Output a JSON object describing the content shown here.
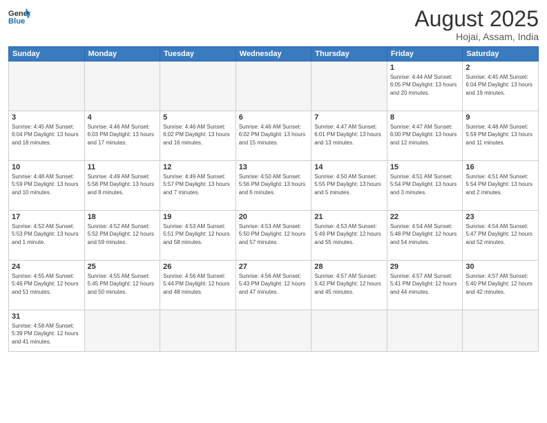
{
  "header": {
    "logo_general": "General",
    "logo_blue": "Blue",
    "month_title": "August 2025",
    "location": "Hojai, Assam, India"
  },
  "days_of_week": [
    "Sunday",
    "Monday",
    "Tuesday",
    "Wednesday",
    "Thursday",
    "Friday",
    "Saturday"
  ],
  "weeks": [
    [
      {
        "day": "",
        "info": "",
        "empty": true
      },
      {
        "day": "",
        "info": "",
        "empty": true
      },
      {
        "day": "",
        "info": "",
        "empty": true
      },
      {
        "day": "",
        "info": "",
        "empty": true
      },
      {
        "day": "",
        "info": "",
        "empty": true
      },
      {
        "day": "1",
        "info": "Sunrise: 4:44 AM\nSunset: 6:05 PM\nDaylight: 13 hours\nand 20 minutes."
      },
      {
        "day": "2",
        "info": "Sunrise: 4:45 AM\nSunset: 6:04 PM\nDaylight: 13 hours\nand 19 minutes."
      }
    ],
    [
      {
        "day": "3",
        "info": "Sunrise: 4:45 AM\nSunset: 6:04 PM\nDaylight: 13 hours\nand 18 minutes."
      },
      {
        "day": "4",
        "info": "Sunrise: 4:46 AM\nSunset: 6:03 PM\nDaylight: 13 hours\nand 17 minutes."
      },
      {
        "day": "5",
        "info": "Sunrise: 4:46 AM\nSunset: 6:02 PM\nDaylight: 13 hours\nand 16 minutes."
      },
      {
        "day": "6",
        "info": "Sunrise: 4:46 AM\nSunset: 6:02 PM\nDaylight: 13 hours\nand 15 minutes."
      },
      {
        "day": "7",
        "info": "Sunrise: 4:47 AM\nSunset: 6:01 PM\nDaylight: 13 hours\nand 13 minutes."
      },
      {
        "day": "8",
        "info": "Sunrise: 4:47 AM\nSunset: 6:00 PM\nDaylight: 13 hours\nand 12 minutes."
      },
      {
        "day": "9",
        "info": "Sunrise: 4:48 AM\nSunset: 5:59 PM\nDaylight: 13 hours\nand 11 minutes."
      }
    ],
    [
      {
        "day": "10",
        "info": "Sunrise: 4:48 AM\nSunset: 5:59 PM\nDaylight: 13 hours\nand 10 minutes."
      },
      {
        "day": "11",
        "info": "Sunrise: 4:49 AM\nSunset: 5:58 PM\nDaylight: 13 hours\nand 8 minutes."
      },
      {
        "day": "12",
        "info": "Sunrise: 4:49 AM\nSunset: 5:57 PM\nDaylight: 13 hours\nand 7 minutes."
      },
      {
        "day": "13",
        "info": "Sunrise: 4:50 AM\nSunset: 5:56 PM\nDaylight: 13 hours\nand 6 minutes."
      },
      {
        "day": "14",
        "info": "Sunrise: 4:50 AM\nSunset: 5:55 PM\nDaylight: 13 hours\nand 5 minutes."
      },
      {
        "day": "15",
        "info": "Sunrise: 4:51 AM\nSunset: 5:54 PM\nDaylight: 13 hours\nand 3 minutes."
      },
      {
        "day": "16",
        "info": "Sunrise: 4:51 AM\nSunset: 5:54 PM\nDaylight: 13 hours\nand 2 minutes."
      }
    ],
    [
      {
        "day": "17",
        "info": "Sunrise: 4:52 AM\nSunset: 5:53 PM\nDaylight: 13 hours\nand 1 minute."
      },
      {
        "day": "18",
        "info": "Sunrise: 4:52 AM\nSunset: 5:52 PM\nDaylight: 12 hours\nand 59 minutes."
      },
      {
        "day": "19",
        "info": "Sunrise: 4:53 AM\nSunset: 5:51 PM\nDaylight: 12 hours\nand 58 minutes."
      },
      {
        "day": "20",
        "info": "Sunrise: 4:53 AM\nSunset: 5:50 PM\nDaylight: 12 hours\nand 57 minutes."
      },
      {
        "day": "21",
        "info": "Sunrise: 4:53 AM\nSunset: 5:49 PM\nDaylight: 12 hours\nand 55 minutes."
      },
      {
        "day": "22",
        "info": "Sunrise: 4:54 AM\nSunset: 5:48 PM\nDaylight: 12 hours\nand 54 minutes."
      },
      {
        "day": "23",
        "info": "Sunrise: 4:54 AM\nSunset: 5:47 PM\nDaylight: 12 hours\nand 52 minutes."
      }
    ],
    [
      {
        "day": "24",
        "info": "Sunrise: 4:55 AM\nSunset: 5:46 PM\nDaylight: 12 hours\nand 51 minutes."
      },
      {
        "day": "25",
        "info": "Sunrise: 4:55 AM\nSunset: 5:45 PM\nDaylight: 12 hours\nand 50 minutes."
      },
      {
        "day": "26",
        "info": "Sunrise: 4:56 AM\nSunset: 5:44 PM\nDaylight: 12 hours\nand 48 minutes."
      },
      {
        "day": "27",
        "info": "Sunrise: 4:56 AM\nSunset: 5:43 PM\nDaylight: 12 hours\nand 47 minutes."
      },
      {
        "day": "28",
        "info": "Sunrise: 4:57 AM\nSunset: 5:42 PM\nDaylight: 12 hours\nand 45 minutes."
      },
      {
        "day": "29",
        "info": "Sunrise: 4:57 AM\nSunset: 5:41 PM\nDaylight: 12 hours\nand 44 minutes."
      },
      {
        "day": "30",
        "info": "Sunrise: 4:57 AM\nSunset: 5:40 PM\nDaylight: 12 hours\nand 42 minutes."
      }
    ],
    [
      {
        "day": "31",
        "info": "Sunrise: 4:58 AM\nSunset: 5:39 PM\nDaylight: 12 hours\nand 41 minutes.",
        "last": true
      },
      {
        "day": "",
        "info": "",
        "empty": true,
        "last": true
      },
      {
        "day": "",
        "info": "",
        "empty": true,
        "last": true
      },
      {
        "day": "",
        "info": "",
        "empty": true,
        "last": true
      },
      {
        "day": "",
        "info": "",
        "empty": true,
        "last": true
      },
      {
        "day": "",
        "info": "",
        "empty": true,
        "last": true
      },
      {
        "day": "",
        "info": "",
        "empty": true,
        "last": true
      }
    ]
  ]
}
